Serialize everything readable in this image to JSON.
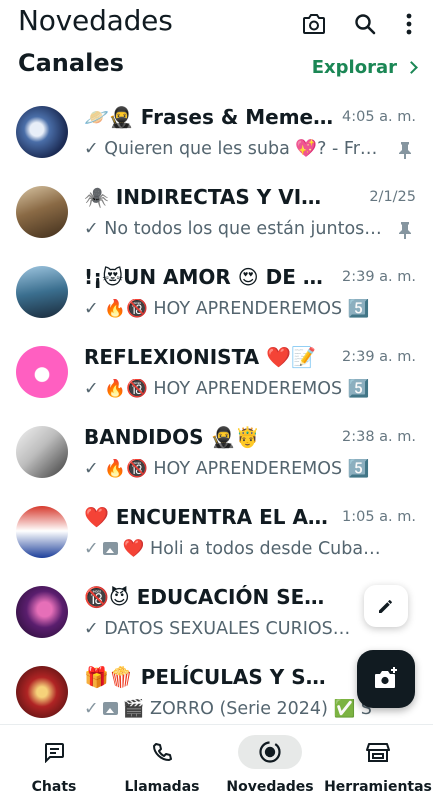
{
  "appbar": {
    "title": "Novedades",
    "icons": [
      "camera-icon",
      "search-icon",
      "more-vert-icon"
    ]
  },
  "section": {
    "title": "Canales",
    "explore_label": "Explorar",
    "explore_icon": "chevron-right-icon"
  },
  "channels": [
    {
      "name": "🪐🥷 Frases & Memes 🤣",
      "time": "4:05 a. m.",
      "preview": "✓ Quieren que les suba 💖? - Frases",
      "pinned": true,
      "avatar_color": "#2a3f6b"
    },
    {
      "name": "🕷️ INDIRECTAS Y VIDEOS 🔥",
      "time": "2/1/25",
      "preview": "✓ No todos los que están juntos se quieren",
      "pinned": true,
      "avatar_color": "#6b4a2e"
    },
    {
      "name": "!¡😻UN AMOR 😍 DE SUEÑO",
      "time": "2:39 a. m.",
      "preview": "✓ 🔥🔞 HOY APRENDEREMOS 5️⃣",
      "pinned": false,
      "avatar_color": "#3b6f8f"
    },
    {
      "name": "REFLEXIONISTA ❤️📝",
      "time": "2:39 a. m.",
      "preview": "✓ 🔥🔞 HOY APRENDEREMOS 5️⃣",
      "pinned": false,
      "avatar_color": "#ff5fc1"
    },
    {
      "name": "BANDIDOS 🥷🤴",
      "time": "2:38 a. m.",
      "preview": "✓ 🔥🔞 HOY APRENDEREMOS 5️⃣",
      "pinned": false,
      "avatar_color": "#bfbfbf"
    },
    {
      "name": "❤️ ENCUENTRA EL AMOR",
      "time": "1:05 a. m.",
      "preview": "❤️ Holi a todos desde Cuba 🇨🇺",
      "pinned": false,
      "avatar_color": "#c0392b",
      "has_image": true
    },
    {
      "name": "🔞😈 EDUCACIÓN SEXUAL 🔥",
      "time": "",
      "preview": "✓ DATOS SEXUALES CURIOSOS 🔥",
      "pinned": false,
      "avatar_color": "#5a1e6e"
    },
    {
      "name": "🎁🍿 PELÍCULAS Y SERIES 🎬",
      "time": "",
      "preview": "🎬 ZORRO (Serie 2024) ✅ S",
      "pinned": false,
      "avatar_color": "#8b1e1e",
      "has_image": true
    }
  ],
  "fab": {
    "pencil_icon": "pencil-icon",
    "camera_icon": "camera-plus-icon"
  },
  "bottom_nav": [
    {
      "label": "Chats",
      "icon": "chats-icon",
      "active": false
    },
    {
      "label": "Llamadas",
      "icon": "phone-icon",
      "active": false
    },
    {
      "label": "Novedades",
      "icon": "updates-icon",
      "active": true
    },
    {
      "label": "Herramientas",
      "icon": "store-icon",
      "active": false
    }
  ],
  "colors": {
    "accent_green": "#1b8755",
    "text_primary": "#111b21",
    "text_secondary": "#54656f",
    "timestamp": "#667781"
  }
}
